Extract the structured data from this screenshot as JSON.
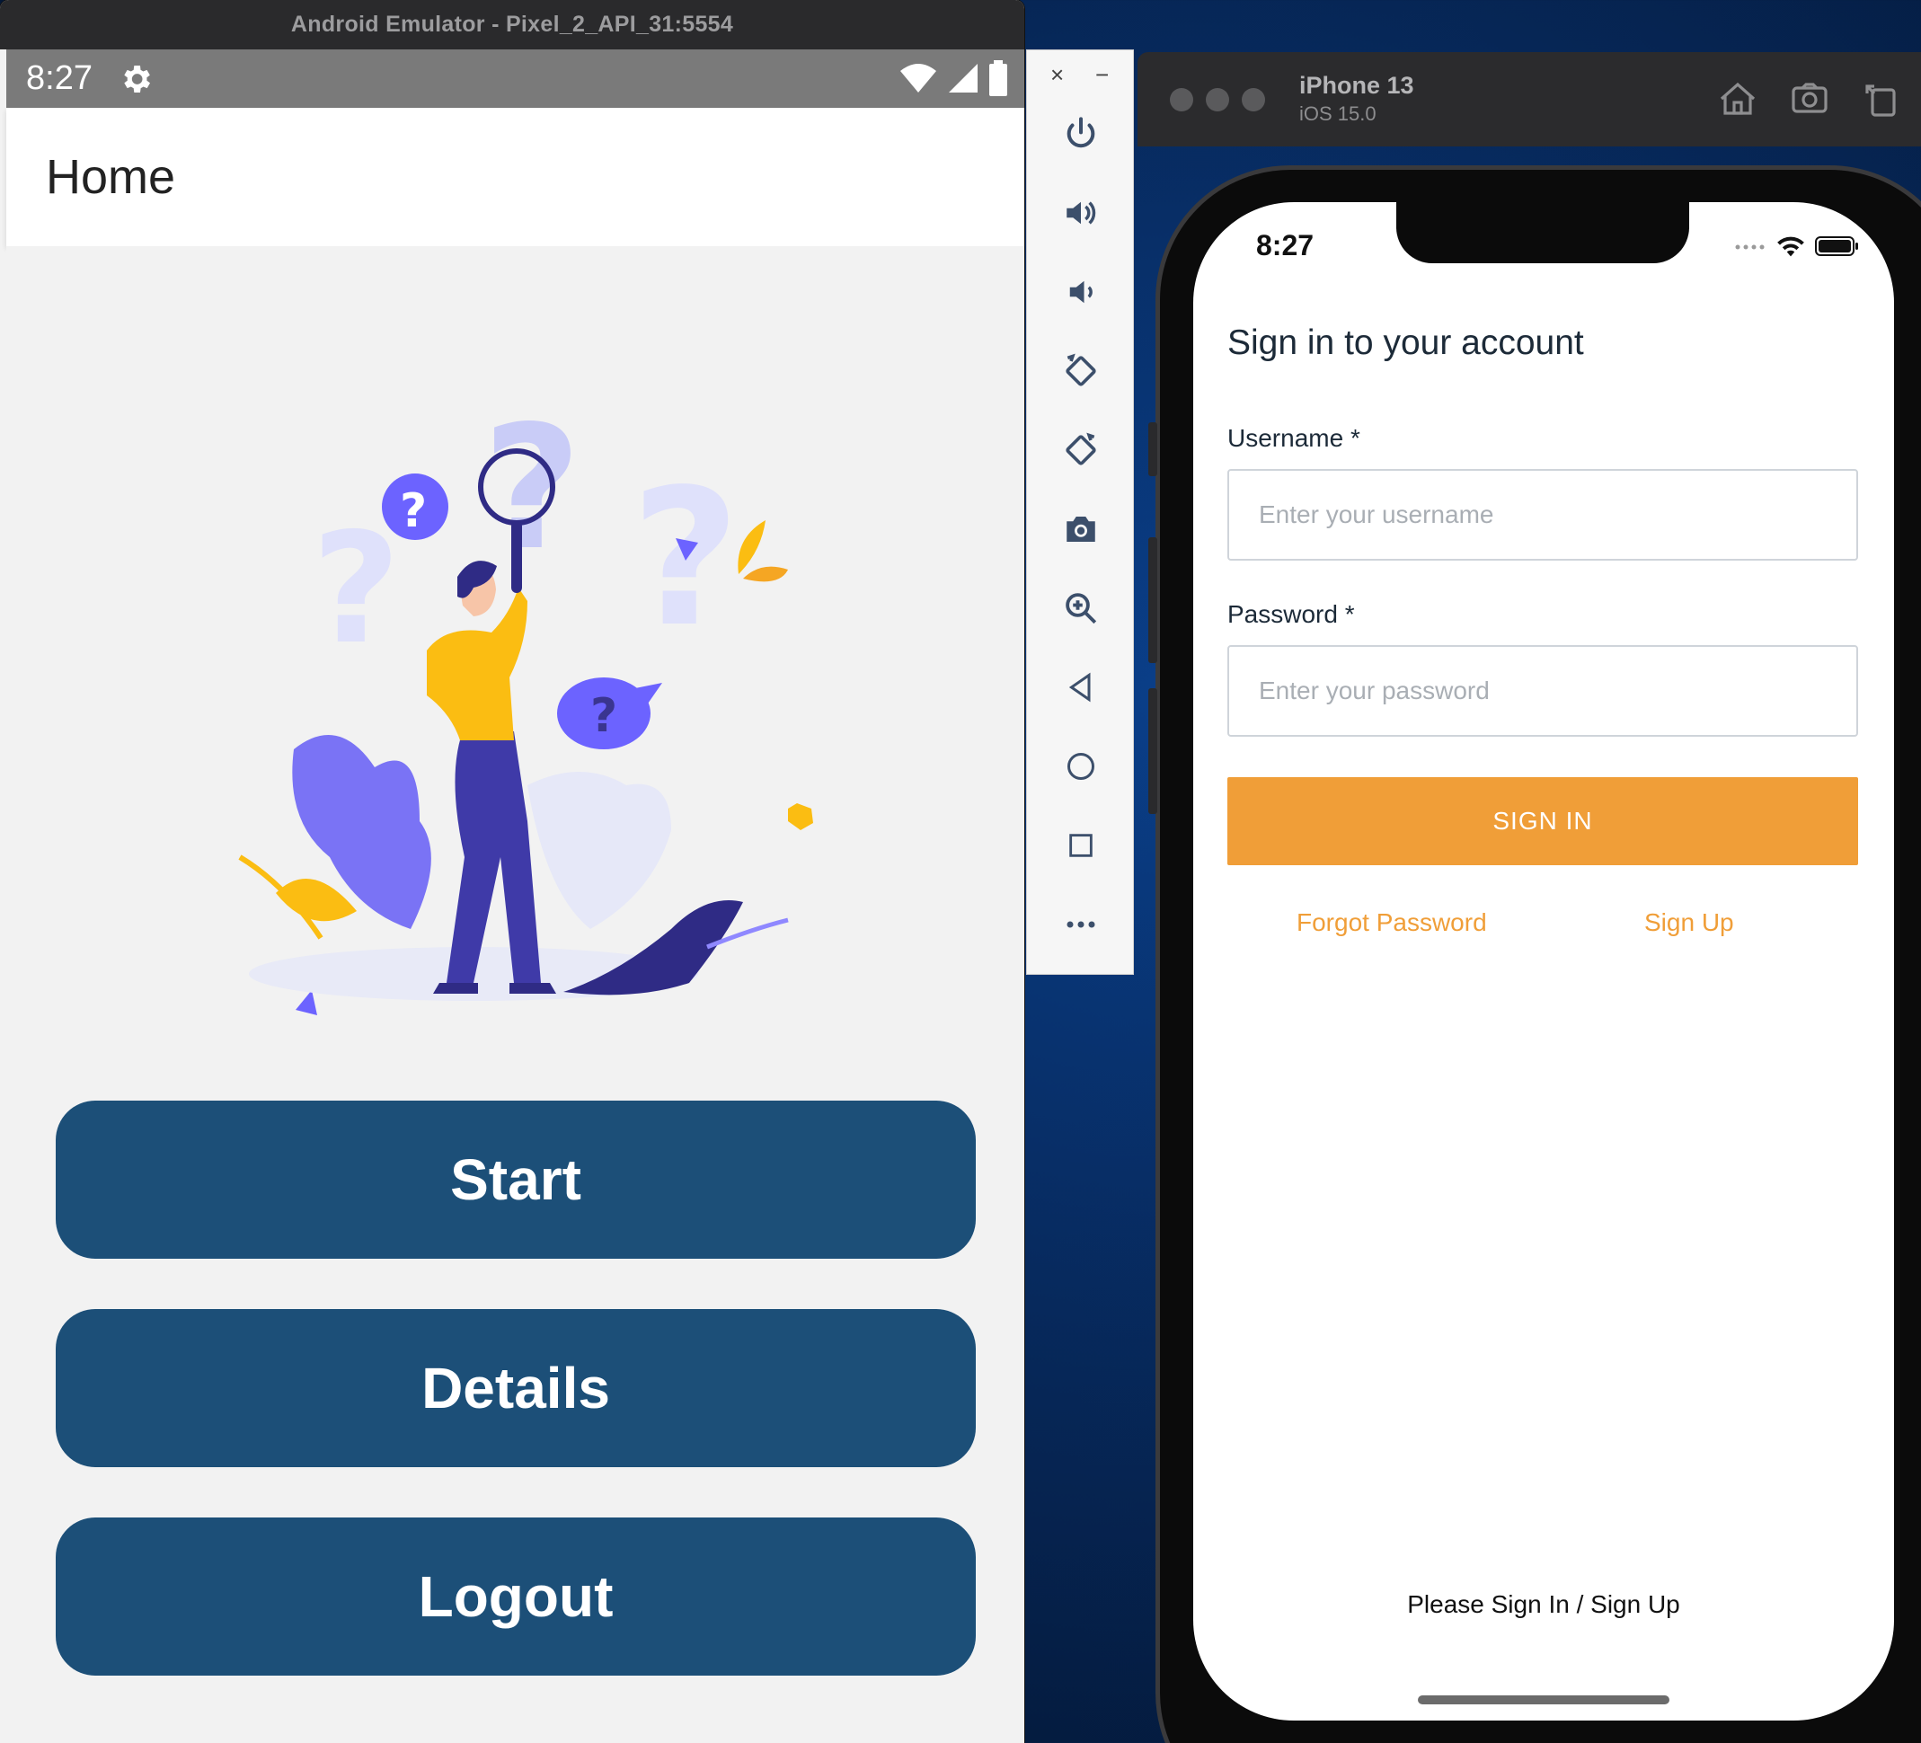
{
  "android_emulator": {
    "window_title": "Android Emulator - Pixel_2_API_31:5554",
    "status_bar": {
      "time": "8:27"
    },
    "app_bar": {
      "title": "Home"
    },
    "buttons": {
      "start": "Start",
      "details": "Details",
      "logout": "Logout"
    },
    "illustration_icon": "person-with-magnifier-question-marks-illustration"
  },
  "emulator_toolbar": {
    "close": "×",
    "minimize": "−",
    "items": [
      "power-icon",
      "volume-up-icon",
      "volume-down-icon",
      "rotate-left-icon",
      "rotate-right-icon",
      "camera-icon",
      "zoom-icon",
      "back-icon",
      "home-icon",
      "overview-icon",
      "more-icon"
    ]
  },
  "ios_simulator": {
    "device_name": "iPhone 13",
    "os_version": "iOS 15.0",
    "status_bar": {
      "time": "8:27"
    },
    "signin": {
      "title": "Sign in to your account",
      "username_label": "Username *",
      "username_placeholder": "Enter your username",
      "password_label": "Password *",
      "password_placeholder": "Enter your password",
      "signin_button": "SIGN IN",
      "forgot_password": "Forgot Password",
      "sign_up": "Sign Up",
      "footer": "Please Sign In / Sign Up"
    }
  },
  "colors": {
    "android_button": "#1c4f78",
    "accent_orange": "#f09e38",
    "illustration_purple": "#6c63ff",
    "illustration_yellow": "#fbbd12"
  }
}
